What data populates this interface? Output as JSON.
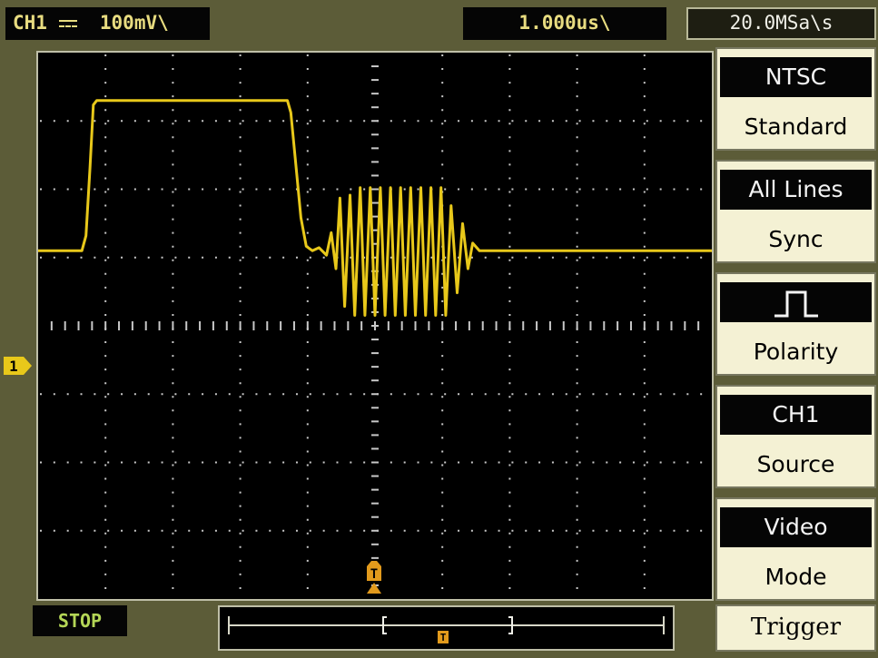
{
  "header": {
    "channel_label": "CH1",
    "coupling_icon": "dc-coupling-icon",
    "channel_scale": "100mV\\",
    "timebase": "1.000us\\",
    "sample_rate": "20.0MSa\\s"
  },
  "colors": {
    "channel1": "#e8c81a",
    "trigger": "#e29a1c",
    "panel_bg": "#5c5c38",
    "menu_bg": "#f4f1d4",
    "status_text": "#b4d656"
  },
  "waveform": {
    "channel": "CH1",
    "points": [
      [
        0,
        0.0
      ],
      [
        0.65,
        0.0
      ],
      [
        0.71,
        0.1
      ],
      [
        0.77,
        0.55
      ],
      [
        0.82,
        0.97
      ],
      [
        0.87,
        1.0
      ],
      [
        1.4,
        1.0
      ],
      [
        2.0,
        1.0
      ],
      [
        2.8,
        1.0
      ],
      [
        3.5,
        1.0
      ],
      [
        3.7,
        1.0
      ],
      [
        3.75,
        0.92
      ],
      [
        3.82,
        0.6
      ],
      [
        3.9,
        0.22
      ],
      [
        3.98,
        0.03
      ],
      [
        4.07,
        0.0
      ],
      [
        4.17,
        0.02
      ],
      [
        4.28,
        -0.03
      ],
      [
        4.35,
        0.12
      ],
      [
        4.42,
        -0.12
      ],
      [
        4.48,
        0.35
      ],
      [
        4.55,
        -0.37
      ],
      [
        4.63,
        0.37
      ],
      [
        4.7,
        -0.43
      ],
      [
        4.78,
        0.42
      ],
      [
        4.85,
        -0.43
      ],
      [
        4.93,
        0.42
      ],
      [
        5.0,
        -0.43
      ],
      [
        5.08,
        0.42
      ],
      [
        5.15,
        -0.43
      ],
      [
        5.23,
        0.42
      ],
      [
        5.3,
        -0.43
      ],
      [
        5.38,
        0.42
      ],
      [
        5.45,
        -0.43
      ],
      [
        5.53,
        0.42
      ],
      [
        5.6,
        -0.43
      ],
      [
        5.68,
        0.42
      ],
      [
        5.75,
        -0.43
      ],
      [
        5.83,
        0.42
      ],
      [
        5.9,
        -0.43
      ],
      [
        5.98,
        0.42
      ],
      [
        6.05,
        -0.43
      ],
      [
        6.13,
        0.3
      ],
      [
        6.22,
        -0.28
      ],
      [
        6.3,
        0.18
      ],
      [
        6.38,
        -0.12
      ],
      [
        6.45,
        0.05
      ],
      [
        6.55,
        0.0
      ],
      [
        7.0,
        0.0
      ],
      [
        10.0,
        0.0
      ]
    ]
  },
  "markers": {
    "channel_ground": "1",
    "trigger_label": "T"
  },
  "status": "STOP",
  "menu": {
    "title": "Trigger",
    "items": [
      {
        "label": "Mode",
        "value": "Video"
      },
      {
        "label": "Source",
        "value": "CH1"
      },
      {
        "label": "Polarity",
        "value": "polarity-positive-icon"
      },
      {
        "label": "Sync",
        "value": "All Lines"
      },
      {
        "label": "Standard",
        "value": "NTSC"
      }
    ]
  }
}
